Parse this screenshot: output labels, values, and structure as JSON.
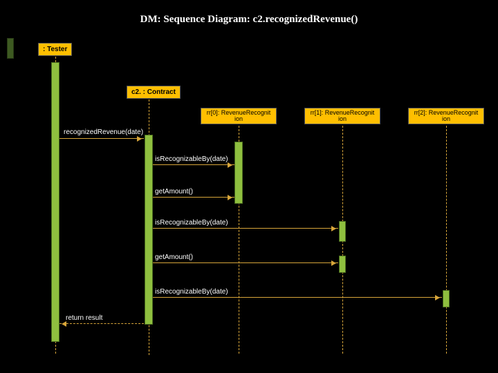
{
  "title": "DM: Sequence Diagram: c2.recognizedRevenue()",
  "participants": {
    "tester": ": Tester",
    "contract": "c2. : Contract",
    "rr0": "rr[0]: RevenueRecognit\nion",
    "rr1": "rr[1]: RevenueRecognit\nion",
    "rr2": "rr[2]: RevenueRecognit\nion"
  },
  "messages": {
    "m1": "recognizedRevenue(date)",
    "m2": "isRecognizableBy(date)",
    "m3": "getAmount()",
    "m4": "isRecognizableBy(date)",
    "m5": "getAmount()",
    "m6": "isRecognizableBy(date)",
    "m7": "return result"
  }
}
